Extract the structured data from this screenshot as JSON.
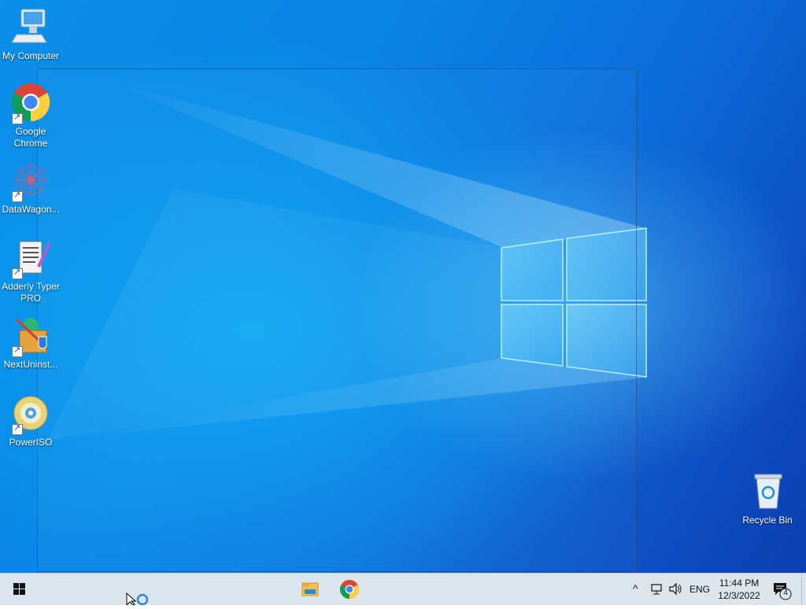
{
  "desktop_icons": [
    {
      "id": "my-computer",
      "label": "My Computer"
    },
    {
      "id": "google-chrome",
      "label": "Google\nChrome"
    },
    {
      "id": "datawagon",
      "label": "DataWagon..."
    },
    {
      "id": "adderly",
      "label": "Adderly Typer\nPRO"
    },
    {
      "id": "nextuninst",
      "label": "NextUninst..."
    },
    {
      "id": "poweriso",
      "label": "PowerISO"
    }
  ],
  "recycle_bin": {
    "label": "Recycle Bin"
  },
  "taskbar": {
    "language": "ENG",
    "time": "11:44 PM",
    "date": "12/3/2022",
    "notification_count": "4"
  },
  "colors": {
    "taskbar_bg": "#dde5ec",
    "desktop_accent": "#0a84e6"
  }
}
